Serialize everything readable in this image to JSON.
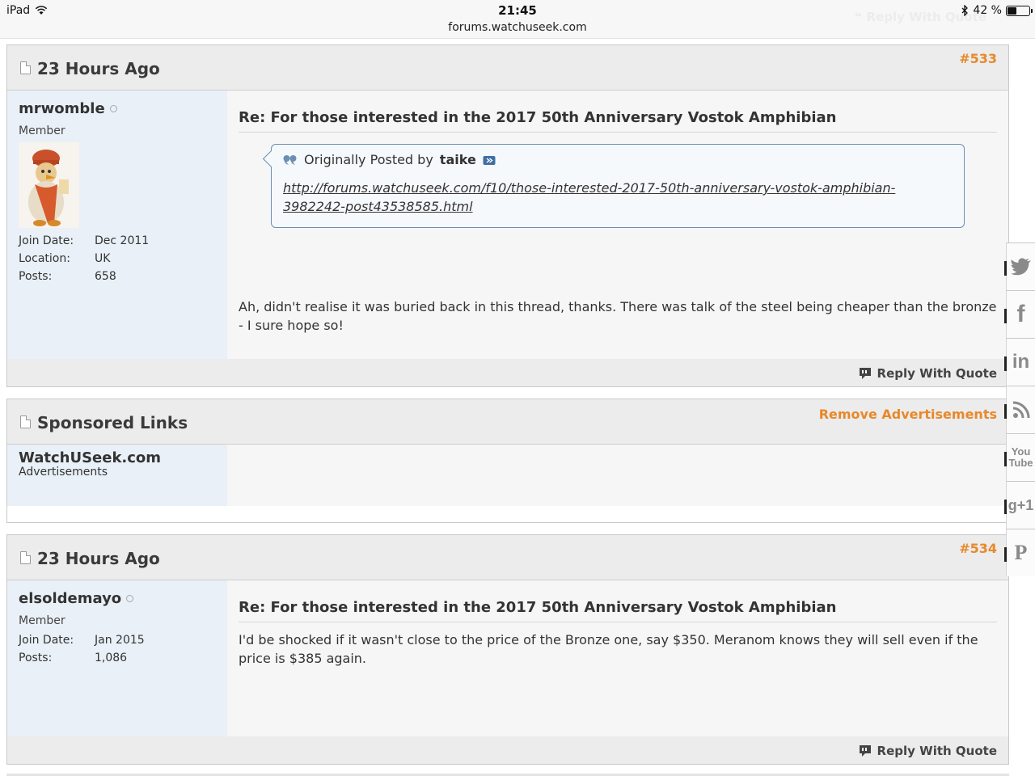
{
  "statusbar": {
    "device": "iPad",
    "time": "21:45",
    "url": "forums.watchuseek.com",
    "battery": "42 %",
    "battery_level": 0.42
  },
  "ghost_header": {
    "label": "Reply With Quote"
  },
  "posts": [
    {
      "date": "23 Hours Ago",
      "number": "#533",
      "username": "mrwomble",
      "usertitle": "Member",
      "stats": [
        {
          "k": "Join Date:",
          "v": "Dec 2011"
        },
        {
          "k": "Location:",
          "v": "UK"
        },
        {
          "k": "Posts:",
          "v": "658"
        }
      ],
      "title": "Re: For those interested in the 2017 50th Anniversary Vostok Amphibian",
      "quote": {
        "prefix": "Originally Posted by",
        "author": "taike",
        "link": "http://forums.watchuseek.com/f10/those-interested-2017-50th-anniversary-vostok-amphibian-3982242-post43538585.html"
      },
      "text": "Ah, didn't realise it was buried back in this thread, thanks. There was talk of the steel being cheaper than the bronze - I sure hope so!",
      "reply_label": "Reply With Quote"
    },
    {
      "date": "23 Hours Ago",
      "number": "#534",
      "username": "elsoldemayo",
      "usertitle": "Member",
      "stats": [
        {
          "k": "Join Date:",
          "v": "Jan 2015"
        },
        {
          "k": "Posts:",
          "v": "1,086"
        }
      ],
      "title": "Re: For those interested in the 2017 50th Anniversary Vostok Amphibian",
      "text": "I'd be shocked if it wasn't close to the price of the Bronze one, say $350. Meranom knows they will sell even if the price is $385 again.",
      "reply_label": "Reply With Quote"
    }
  ],
  "sponsored": {
    "title": "Sponsored Links",
    "remove_label": "Remove Advertisements",
    "name": "WatchUSeek.com",
    "sub": "Advertisements"
  },
  "social": [
    {
      "icon": "twitter-icon",
      "glyph": "🐦"
    },
    {
      "icon": "facebook-icon",
      "glyph": "f"
    },
    {
      "icon": "linkedin-icon",
      "glyph": "in"
    },
    {
      "icon": "rss-icon",
      "glyph": "◔"
    },
    {
      "icon": "youtube-icon",
      "glyph": "You Tube"
    },
    {
      "icon": "google-plus-icon",
      "glyph": "g+1"
    },
    {
      "icon": "pinterest-icon",
      "glyph": "P"
    }
  ]
}
